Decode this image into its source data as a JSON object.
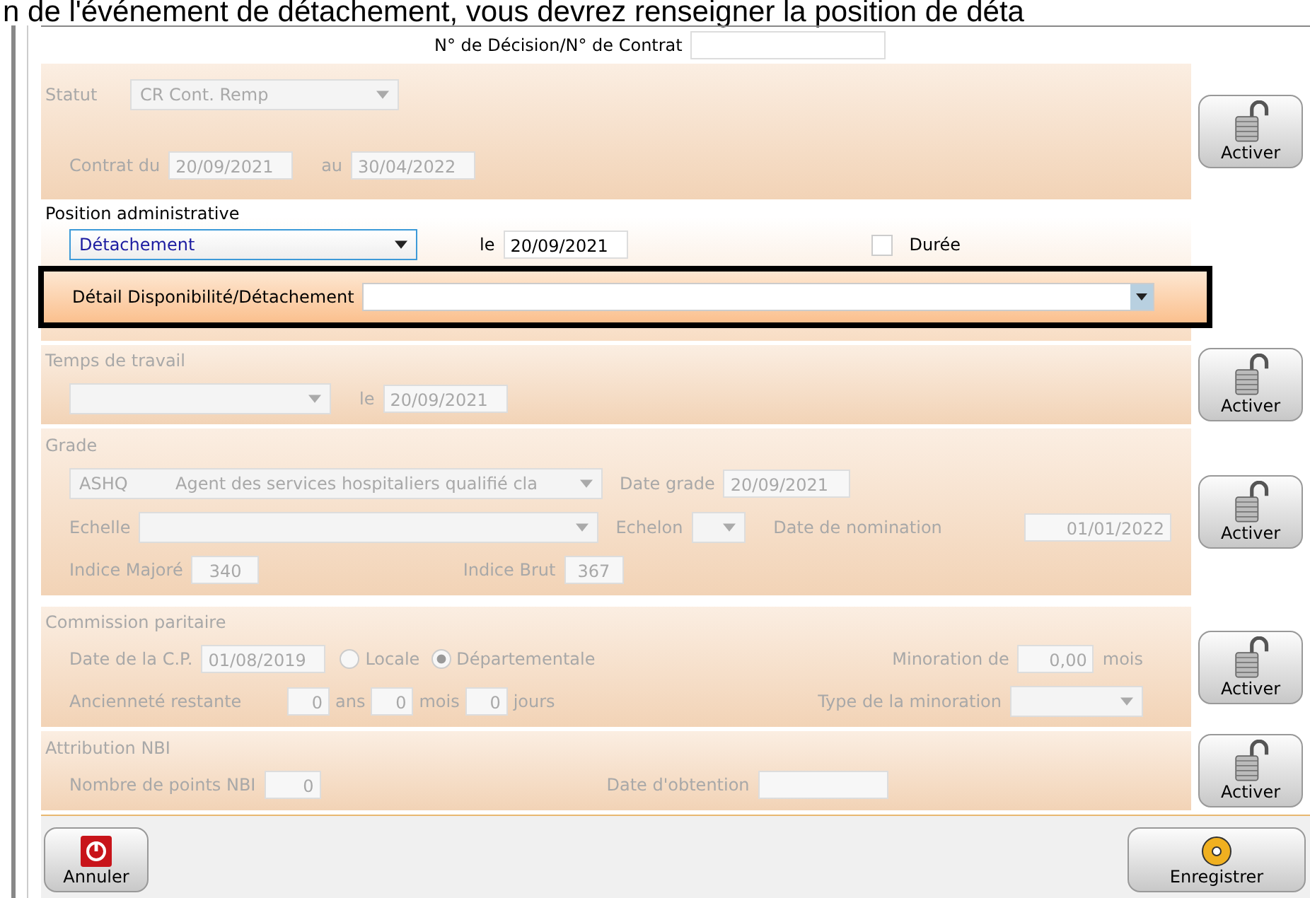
{
  "banner": "n de l'événement de détachement, vous devrez renseigner la position de déta",
  "decision_label": "N° de Décision/N° de Contrat",
  "statut": {
    "disabled": true,
    "label": "Statut",
    "value": "CR Cont. Remp",
    "from_label": "Contrat du",
    "from": "20/09/2021",
    "to_label": "au",
    "to": "30/04/2022",
    "button": "Activer"
  },
  "position": {
    "disabled": false,
    "title": "Position administrative",
    "value": "Détachement",
    "date_label": "le",
    "date": "20/09/2021",
    "duree": {
      "label": "Durée",
      "checked": false
    },
    "detail": {
      "label": "Détail Disponibilité/Détachement",
      "highlighted": true
    }
  },
  "temps": {
    "disabled": true,
    "title": "Temps de travail",
    "date_label": "le",
    "date": "20/09/2021",
    "button": "Activer"
  },
  "grade": {
    "disabled": true,
    "title": "Grade",
    "code": "ASHQ",
    "name": "Agent des services hospitaliers qualifié cla",
    "date_label": "Date grade",
    "date": "20/09/2021",
    "echelle_label": "Echelle",
    "echelon_label": "Echelon",
    "nomination_label": "Date de nomination",
    "nomination": "01/01/2022",
    "im_label": "Indice Majoré",
    "im": "340",
    "ib_label": "Indice Brut",
    "ib": "367",
    "button": "Activer"
  },
  "commission": {
    "disabled": true,
    "title": "Commission paritaire",
    "date_label": "Date de la C.P.",
    "date": "01/08/2019",
    "radios": [
      {
        "label": "Locale",
        "selected": false
      },
      {
        "label": "Départementale",
        "selected": true
      }
    ],
    "minoration_label": "Minoration de",
    "minoration": "0,00",
    "minoration_unit": "mois",
    "anc_label": "Ancienneté restante",
    "anc": [
      {
        "value": "0",
        "unit": "ans"
      },
      {
        "value": "0",
        "unit": "mois"
      },
      {
        "value": "0",
        "unit": "jours"
      }
    ],
    "type_label": "Type de la minoration",
    "button": "Activer"
  },
  "nbi": {
    "disabled": true,
    "title": "Attribution NBI",
    "points_label": "Nombre de points NBI",
    "points": "0",
    "date_label": "Date d'obtention",
    "button": "Activer"
  },
  "footer": {
    "cancel": "Annuler",
    "save": "Enregistrer"
  }
}
